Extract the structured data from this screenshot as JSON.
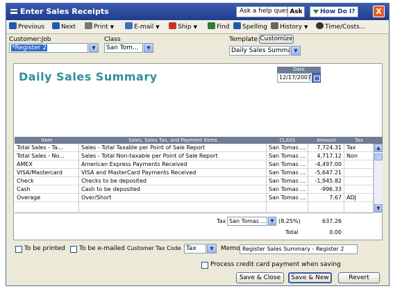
{
  "window": {
    "title": "Enter Sales Receipts",
    "help_placeholder": "Ask a help question",
    "ask_label": "Ask",
    "howdo_label": "How Do I?",
    "close_label": "X"
  },
  "toolbar": {
    "items": [
      {
        "label": "Previous",
        "icon": "previous-icon",
        "color": "#1f5ab0"
      },
      {
        "label": "Next",
        "icon": "next-icon",
        "color": "#1f5ab0"
      },
      {
        "label": "Print",
        "icon": "print-icon",
        "color": "#666666",
        "dropdown": true
      },
      {
        "label": "E-mail",
        "icon": "email-icon",
        "color": "#3a6fc0",
        "dropdown": true
      },
      {
        "label": "Ship",
        "icon": "ship-icon",
        "color": "#c0392b",
        "dropdown": true
      },
      {
        "label": "Find",
        "icon": "find-icon",
        "color": "#2e7d32"
      },
      {
        "label": "Spelling",
        "icon": "spelling-icon",
        "color": "#1f5ab0"
      },
      {
        "label": "History",
        "icon": "history-icon",
        "color": "#555555",
        "dropdown": true
      },
      {
        "label": "Time/Costs...",
        "icon": "time-costs-icon",
        "color": "#333333"
      }
    ]
  },
  "header": {
    "customer_label": "Customer:Job",
    "customer_value": "*Register 2",
    "class_label": "Class",
    "class_value": "San Tom...",
    "template_label": "Template",
    "customize_label": "Customize",
    "template_value": "Daily Sales Summary"
  },
  "form": {
    "title": "Daily Sales Summary",
    "date_label": "Date",
    "date_value": "12/17/2007"
  },
  "grid": {
    "columns": [
      "Item",
      "Sales, Sales Tax, and Payment Items",
      "CLASS",
      "Amount",
      "Tax"
    ],
    "rows": [
      {
        "item": "Total Sales - Ta...",
        "desc": "Sales - Total Taxable per Point of Sale Report",
        "class": "San Tomas ...",
        "amount": "7,724.31",
        "tax": "Tax"
      },
      {
        "item": "Total Sales - No...",
        "desc": "Sales - Total Non-taxable per Point of Sale Report",
        "class": "San Tomas ...",
        "amount": "4,717.12",
        "tax": "Non"
      },
      {
        "item": "AMEX",
        "desc": "American Express Payments Received",
        "class": "San Tomas ...",
        "amount": "-4,497.00",
        "tax": ""
      },
      {
        "item": "VISA/Mastercard",
        "desc": "VISA and MasterCard Payments Received",
        "class": "San Tomas ...",
        "amount": "-5,647.21",
        "tax": ""
      },
      {
        "item": "Check",
        "desc": "Checks to be deposited",
        "class": "San Tomas ...",
        "amount": "-1,945.82",
        "tax": ""
      },
      {
        "item": "Cash",
        "desc": "Cash to be deposited",
        "class": "San Tomas ...",
        "amount": "-996.33",
        "tax": ""
      },
      {
        "item": "Overage",
        "desc": "Over/Short",
        "class": "San Tomas ...",
        "amount": "7.67",
        "tax": "ADJ"
      },
      {
        "item": "",
        "desc": "",
        "class": "",
        "amount": "",
        "tax": ""
      }
    ]
  },
  "totals": {
    "tax_label": "Tax",
    "tax_item": "San Tomas ...",
    "tax_rate": "(8.25%)",
    "tax_amount": "637.26",
    "total_label": "Total",
    "total_amount": "0.00"
  },
  "footer": {
    "to_be_printed": "To be printed",
    "to_be_emailed": "To be e-mailed",
    "customer_tax_code_label": "Customer Tax Code",
    "customer_tax_code_value": "Tax",
    "memo_label": "Memo",
    "memo_value": "Register Sales Summary - Register 2",
    "process_cc_label": "Process credit card payment when saving",
    "save_close_label": "Save & Close",
    "save_new_label": "Save & New",
    "revert_label": "Revert"
  }
}
